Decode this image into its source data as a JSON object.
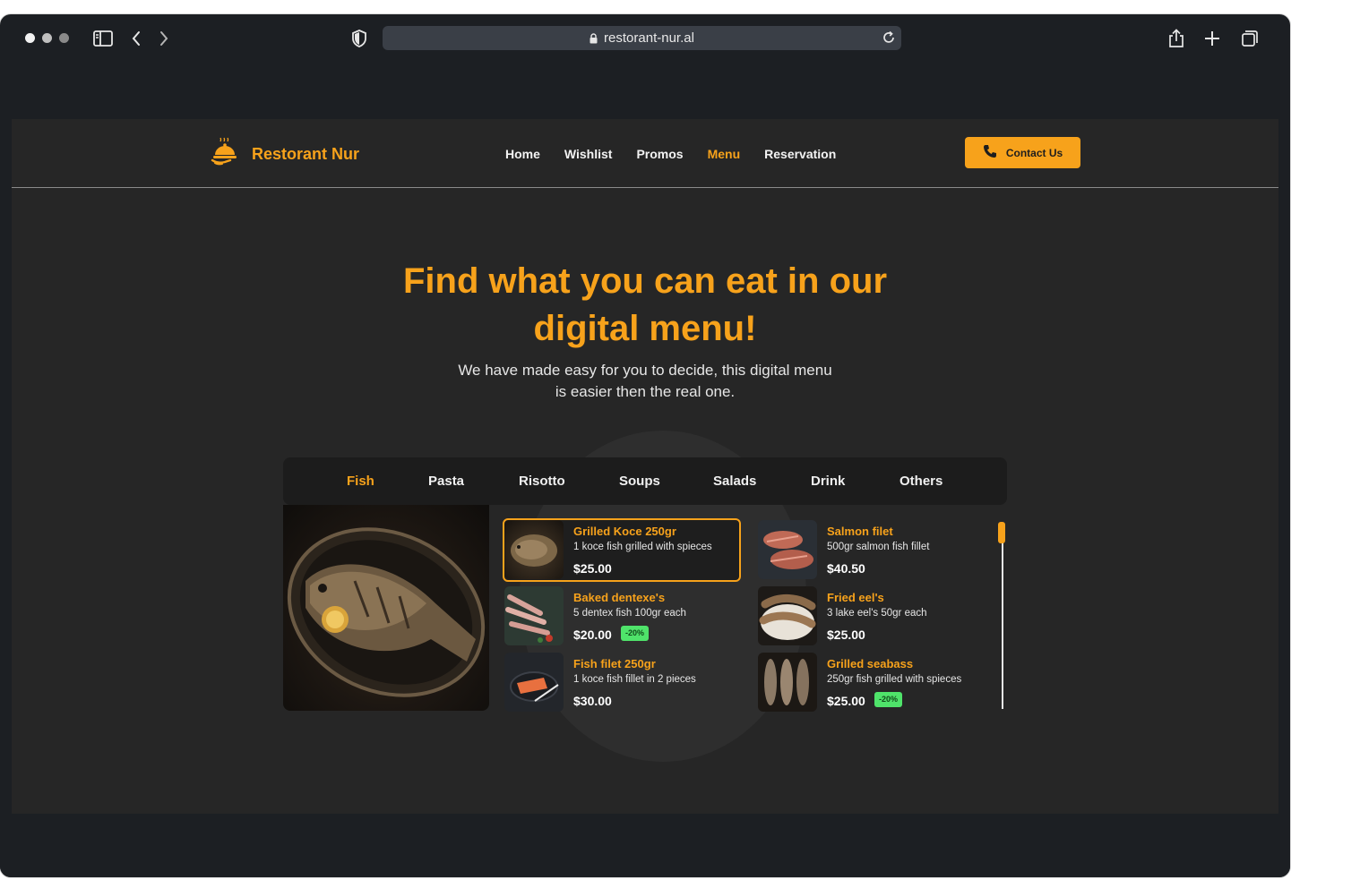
{
  "browser": {
    "url": "restorant-nur.al",
    "icons": [
      "sidebar-icon",
      "back-icon",
      "forward-icon",
      "shield-icon",
      "lock-icon",
      "reload-icon",
      "share-icon",
      "new-tab-icon",
      "tabs-icon"
    ]
  },
  "nav": {
    "brand": "Restorant Nur",
    "links": [
      "Home",
      "Wishlist",
      "Promos",
      "Menu",
      "Reservation"
    ],
    "active": "Menu",
    "contact_label": "Contact Us"
  },
  "hero": {
    "title_line1": "Find what you can eat in our",
    "title_line2": "digital menu!",
    "subtitle_line1": "We have made easy for you to decide, this digital menu",
    "subtitle_line2": "is easier then the real one."
  },
  "categories": [
    "Fish",
    "Pasta",
    "Risotto",
    "Soups",
    "Salads",
    "Drink",
    "Others"
  ],
  "active_category": "Fish",
  "dishes": [
    {
      "name": "Grilled Koce 250gr",
      "desc": "1 koce fish grilled with spieces",
      "price": "$25.00",
      "badge": "",
      "selected": true
    },
    {
      "name": "Salmon filet",
      "desc": "500gr salmon fish fillet",
      "price": "$40.50",
      "badge": ""
    },
    {
      "name": "Baked dentexe's",
      "desc": "5 dentex fish 100gr each",
      "price": "$20.00",
      "badge": "-20%"
    },
    {
      "name": "Fried eel's",
      "desc": "3 lake eel's 50gr each",
      "price": "$25.00",
      "badge": ""
    },
    {
      "name": "Fish filet 250gr",
      "desc": "1 koce fish fillet in 2 pieces",
      "price": "$30.00",
      "badge": ""
    },
    {
      "name": "Grilled seabass",
      "desc": "250gr fish grilled with spieces",
      "price": "$25.00",
      "badge": "-20%"
    }
  ],
  "colors": {
    "accent": "#f7a21b",
    "page_bg": "#262626",
    "badge": "#4fe36a"
  }
}
